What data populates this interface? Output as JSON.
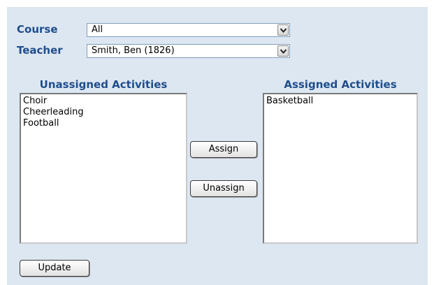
{
  "filters": {
    "course_label": "Course",
    "course_value": "All",
    "teacher_label": "Teacher",
    "teacher_value": "Smith, Ben (1826)"
  },
  "unassigned": {
    "title": "Unassigned Activities",
    "items": [
      "Choir",
      "Cheerleading",
      "Football"
    ]
  },
  "assigned": {
    "title": "Assigned Activities",
    "items": [
      "Basketball"
    ]
  },
  "buttons": {
    "assign": "Assign",
    "unassign": "Unassign",
    "update": "Update"
  },
  "icons": {
    "dropdown": "chevron-down-icon"
  },
  "colors": {
    "panel_bg": "#dde7f2",
    "label_color": "#1f4e8c"
  }
}
